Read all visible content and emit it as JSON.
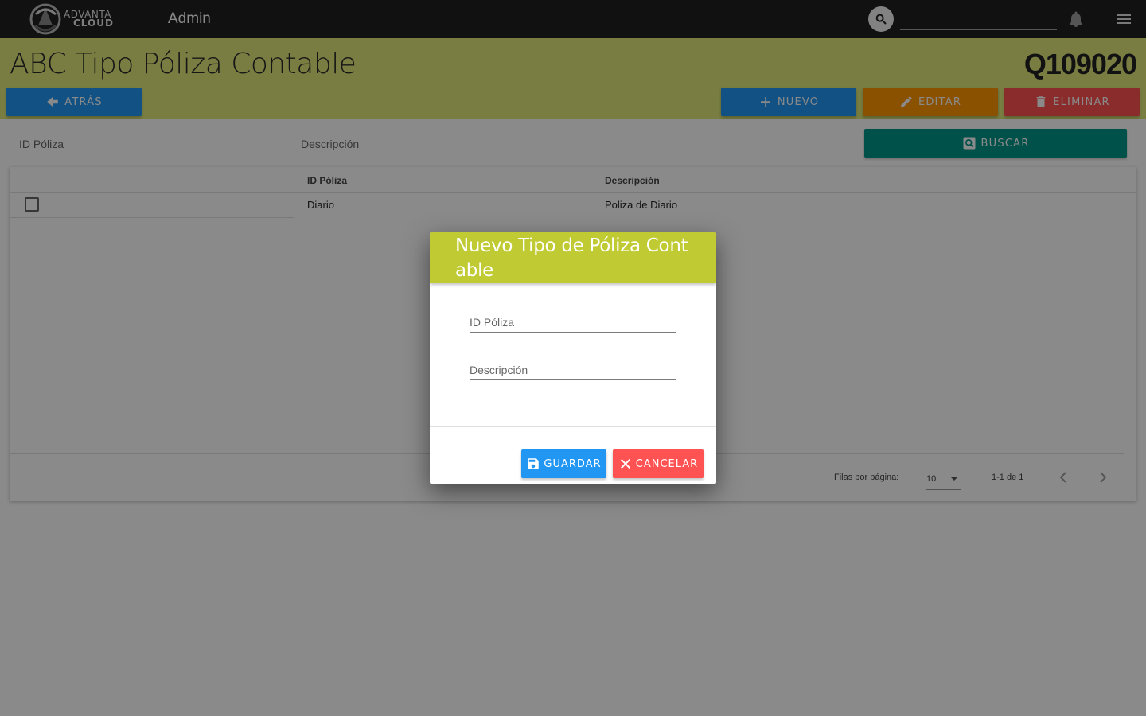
{
  "topbar": {
    "logo_line1": "ADVANTA",
    "logo_line2": "CLOUD",
    "app_name": "Admin",
    "search_value": ""
  },
  "header": {
    "title": "ABC Tipo Póliza Contable",
    "code": "Q109020",
    "buttons": {
      "back": "ATRÁS",
      "new": "NUEVO",
      "edit": "EDITAR",
      "delete": "ELIMINAR",
      "search": "BUSCAR"
    }
  },
  "filters": {
    "id_placeholder": "ID Póliza",
    "desc_placeholder": "Descripción"
  },
  "table": {
    "columns": [
      "ID Póliza",
      "Descripción"
    ],
    "rows": [
      {
        "id": "Diario",
        "description": "Poliza de Diario",
        "checked": false
      }
    ],
    "footer": {
      "rows_per_page_label": "Filas por página:",
      "rows_per_page_value": "10",
      "page_info": "1-1 de 1"
    }
  },
  "dialog": {
    "title": "Nuevo Tipo de Póliza Contable",
    "id_placeholder": "ID Póliza",
    "desc_placeholder": "Descripción",
    "save_label": "GUARDAR",
    "cancel_label": "CANCELAR"
  },
  "colors": {
    "topbar": "#202020",
    "header_band": "#dfe87a",
    "primary": "#2196f3",
    "warning": "#ff9800",
    "danger": "#ff5252",
    "teal": "#009688",
    "dialog_head": "#c0ca33"
  },
  "icons": [
    "logo-mark",
    "search-icon",
    "bell-icon",
    "menu-icon",
    "arrow-left-icon",
    "plus-icon",
    "pencil-icon",
    "trash-icon",
    "search-box-icon",
    "chevron-left-icon",
    "chevron-right-icon",
    "floppy-icon",
    "close-icon"
  ]
}
